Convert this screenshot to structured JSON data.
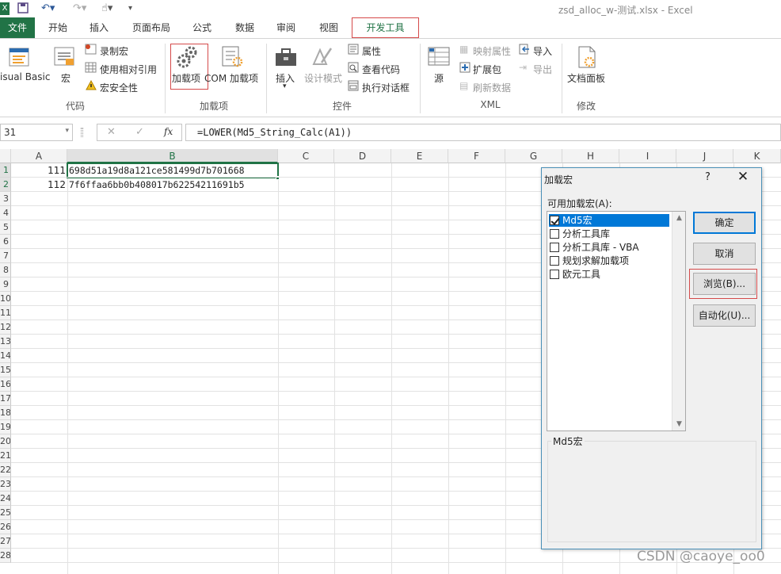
{
  "app": {
    "window_title": "zsd_alloc_w-测试.xlsx - Excel"
  },
  "tabs": [
    {
      "label": "文件"
    },
    {
      "label": "开始"
    },
    {
      "label": "插入"
    },
    {
      "label": "页面布局"
    },
    {
      "label": "公式"
    },
    {
      "label": "数据"
    },
    {
      "label": "审阅"
    },
    {
      "label": "视图"
    },
    {
      "label": "开发工具"
    }
  ],
  "ribbon": {
    "code": {
      "group_label": "代码",
      "visual_basic": "isual Basic",
      "macros": "宏",
      "record_macro": "录制宏",
      "relative_refs": "使用相对引用",
      "macro_security": "宏安全性"
    },
    "addins": {
      "group_label": "加载项",
      "addins": "加载项",
      "com_addins": "COM 加载项"
    },
    "controls": {
      "group_label": "控件",
      "insert": "插入",
      "design_mode": "设计模式",
      "properties": "属性",
      "view_code": "查看代码",
      "run_dialog": "执行对话框"
    },
    "xml": {
      "group_label": "XML",
      "source": "源",
      "map_properties": "映射属性",
      "expansion_packs": "扩展包",
      "refresh_data": "刷新数据",
      "import": "导入",
      "export": "导出"
    },
    "modify": {
      "group_label": "修改",
      "document_panel": "文档面板"
    }
  },
  "formula_bar": {
    "name_box": "31",
    "fx": "fx",
    "formula": "=LOWER(Md5_String_Calc(A1))"
  },
  "sheet": {
    "columns": [
      "A",
      "B",
      "C",
      "D",
      "E",
      "F",
      "G",
      "H",
      "I",
      "J",
      "K"
    ],
    "rows": [
      "1",
      "2",
      "3",
      "4",
      "5",
      "6",
      "7",
      "8",
      "9",
      "10",
      "11",
      "12",
      "13",
      "14",
      "15",
      "16",
      "17",
      "18",
      "19",
      "20",
      "21",
      "22",
      "23",
      "24",
      "25",
      "26",
      "27",
      "28"
    ],
    "cells": {
      "a1": "111",
      "b1": "698d51a19d8a121ce581499d7b701668",
      "a2": "112",
      "b2": "7f6ffaa6bb0b408017b62254211691b5"
    }
  },
  "dialog": {
    "title": "加载宏",
    "help": "?",
    "close": "✕",
    "list_label": "可用加载宏(A):",
    "items": [
      {
        "label": "Md5宏",
        "checked": true
      },
      {
        "label": "分析工具库",
        "checked": false
      },
      {
        "label": "分析工具库 - VBA",
        "checked": false
      },
      {
        "label": "规划求解加载项",
        "checked": false
      },
      {
        "label": "欧元工具",
        "checked": false
      }
    ],
    "ok": "确定",
    "cancel": "取消",
    "browse": "浏览(B)...",
    "automation": "自动化(U)...",
    "description_title": "Md5宏"
  },
  "watermark": "CSDN @caoye_oo0",
  "colors": {
    "excel_green": "#217346",
    "highlight_red": "#d54a4a",
    "selection_blue": "#0078d7"
  }
}
